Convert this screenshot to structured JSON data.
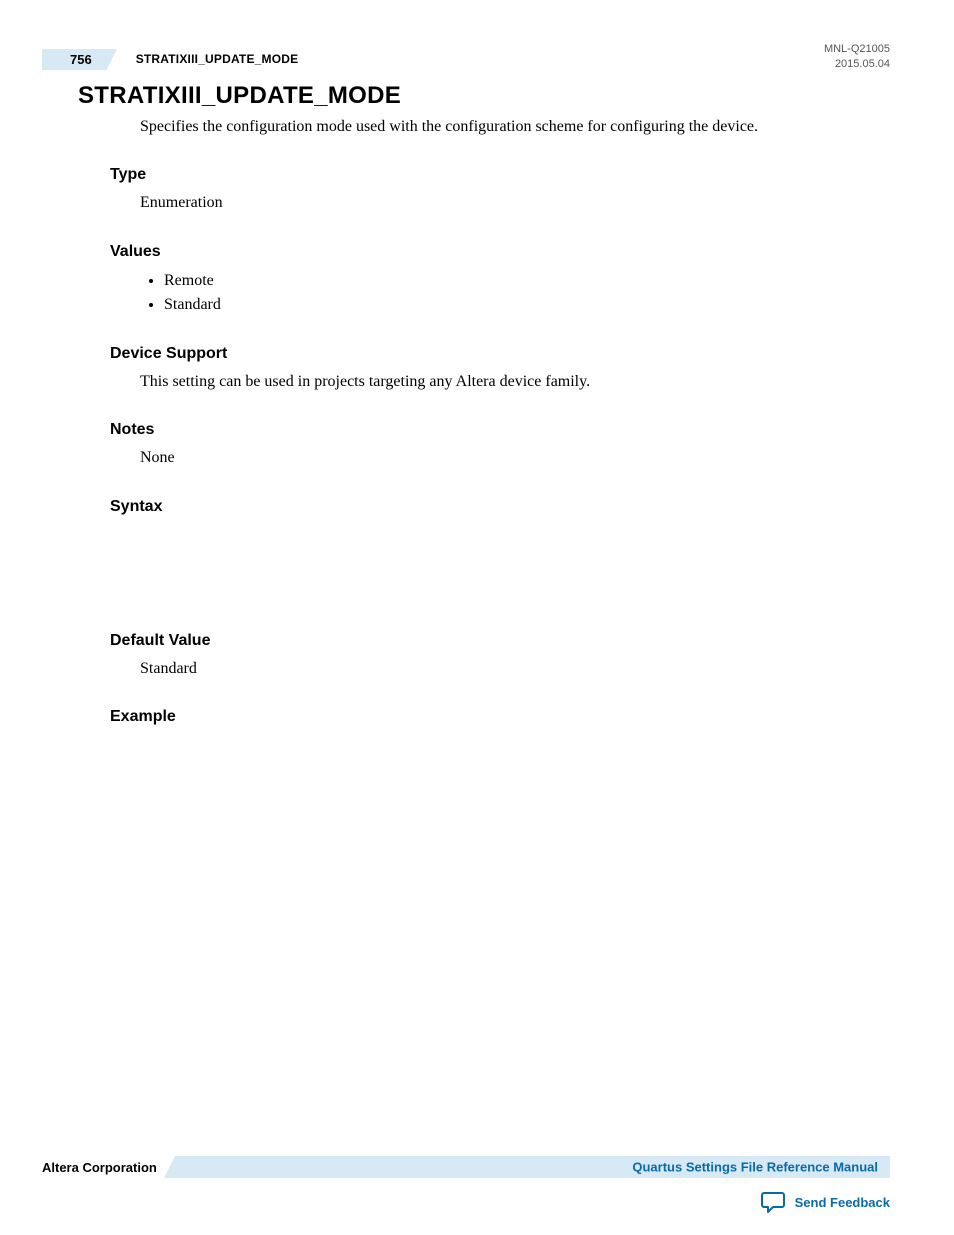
{
  "header": {
    "page_number": "756",
    "running_title": "STRATIXIII_UPDATE_MODE",
    "doc_id": "MNL-Q21005",
    "doc_date": "2015.05.04"
  },
  "content": {
    "title": "STRATIXIII_UPDATE_MODE",
    "intro": "Specifies the configuration mode used with the configuration scheme for configuring the device.",
    "type_h": "Type",
    "type_body": "Enumeration",
    "values_h": "Values",
    "values": [
      "Remote",
      "Standard"
    ],
    "device_support_h": "Device Support",
    "device_support_body": "This setting can be used in projects targeting any Altera device family.",
    "notes_h": "Notes",
    "notes_body": "None",
    "syntax_h": "Syntax",
    "default_value_h": "Default Value",
    "default_value_body": "Standard",
    "example_h": "Example"
  },
  "footer": {
    "company": "Altera Corporation",
    "manual_link": "Quartus Settings File Reference Manual",
    "feedback_label": "Send Feedback"
  }
}
